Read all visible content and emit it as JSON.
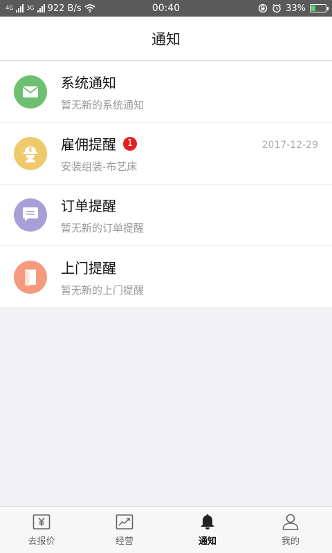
{
  "status_bar": {
    "network_1": "4G",
    "network_2": "3G",
    "speed": "922 B/s",
    "time": "00:40",
    "battery": "33%",
    "battery_level": 0.33
  },
  "header": {
    "title": "通知"
  },
  "notifications": [
    {
      "title": "系统通知",
      "subtitle": "暂无新的系统通知",
      "color": "#6cc070",
      "icon": "mail-icon"
    },
    {
      "title": "雇佣提醒",
      "subtitle": "安装组装-布艺床",
      "badge": "1",
      "date": "2017-12-29",
      "color": "#efca6c",
      "icon": "worker-icon"
    },
    {
      "title": "订单提醒",
      "subtitle": "暂无新的订单提醒",
      "color": "#a79fd8",
      "icon": "message-icon"
    },
    {
      "title": "上门提醒",
      "subtitle": "暂无新的上门提醒",
      "color": "#f59a7e",
      "icon": "door-icon"
    }
  ],
  "tabbar": {
    "items": [
      {
        "label": "去报价",
        "icon": "yen-icon"
      },
      {
        "label": "经营",
        "icon": "trend-icon"
      },
      {
        "label": "通知",
        "icon": "bell-icon",
        "active": true
      },
      {
        "label": "我的",
        "icon": "user-icon"
      }
    ]
  }
}
